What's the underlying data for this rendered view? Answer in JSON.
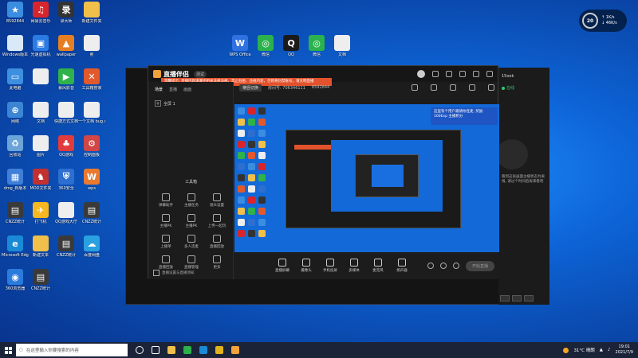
{
  "desktop": {
    "icons": [
      {
        "label": "8592844",
        "color": "#3b8de0",
        "glyph": "★"
      },
      {
        "label": "网易云音乐",
        "color": "#d8252b",
        "glyph": "♫"
      },
      {
        "label": "录大师",
        "color": "#333333",
        "glyph": "录"
      },
      {
        "label": "新建文件夹",
        "color": "#f0c04a",
        "glyph": ""
      },
      {
        "label": "Windows版本",
        "color": "#d9e9f7",
        "glyph": ""
      },
      {
        "label": "光速虚拟机",
        "color": "#2a7be4",
        "glyph": "▣"
      },
      {
        "label": "wallpaper",
        "color": "#e67e22",
        "glyph": "▲"
      },
      {
        "label": "照",
        "color": "#eeeeee",
        "glyph": ""
      },
      {
        "label": "此电脑",
        "color": "#3d8fe0",
        "glyph": "▭"
      },
      {
        "label": "",
        "color": "#eeeeee",
        "glyph": ""
      },
      {
        "label": "暴风影音",
        "color": "#2fb24a",
        "glyph": "▶"
      },
      {
        "label": "工具箱管家",
        "color": "#e2592c",
        "glyph": "✕"
      },
      {
        "label": "网络",
        "color": "#3b86d4",
        "glyph": "⊕"
      },
      {
        "label": "文档",
        "color": "#eeeeee",
        "glyph": ""
      },
      {
        "label": "快捷方式文档",
        "color": "#eeeeee",
        "glyph": ""
      },
      {
        "label": "一个文档 bug.docx",
        "color": "#eeeeee",
        "glyph": ""
      },
      {
        "label": "回收站",
        "color": "#6aa4d8",
        "glyph": "♻"
      },
      {
        "label": "图片",
        "color": "#eeeeee",
        "glyph": ""
      },
      {
        "label": "QQ游戏",
        "color": "#e23b3b",
        "glyph": "♣"
      },
      {
        "label": "控制面板",
        "color": "#d14646",
        "glyph": "⚙"
      },
      {
        "label": "dmg_新版本",
        "color": "#3f7fd8",
        "glyph": "▦"
      },
      {
        "label": "MOD文件夹",
        "color": "#c23030",
        "glyph": "♞"
      },
      {
        "label": "360安全",
        "color": "#2d6fd1",
        "glyph": "⛨"
      },
      {
        "label": "wps",
        "color": "#e97a2f",
        "glyph": "W"
      },
      {
        "label": "CNZZ统计",
        "color": "#3a3a3a",
        "glyph": "▤"
      },
      {
        "label": "打飞机",
        "color": "#f6b821",
        "glyph": "✈"
      },
      {
        "label": "QQ游戏大厅",
        "color": "#eeeeee",
        "glyph": ""
      },
      {
        "label": "CNZZ统计",
        "color": "#3a3a3a",
        "glyph": "▤"
      },
      {
        "label": "Microsoft Edge",
        "color": "#1b8ad6",
        "glyph": "e"
      },
      {
        "label": "新建文本",
        "color": "#f0c04a",
        "glyph": ""
      },
      {
        "label": "CNZZ统计",
        "color": "#3a3a3a",
        "glyph": "▤"
      },
      {
        "label": "百度网盘",
        "color": "#2aa0e0",
        "glyph": "☁"
      },
      {
        "label": "360浏览器",
        "color": "#2b7bdc",
        "glyph": "◉"
      },
      {
        "label": "CNZZ统计",
        "color": "#3a3a3a",
        "glyph": "▤"
      }
    ],
    "top_icons": [
      {
        "label": "WPS Office",
        "color": "#2f71e0",
        "glyph": "W"
      },
      {
        "label": "微信",
        "color": "#2bb24c",
        "glyph": "◎"
      },
      {
        "label": "QQ",
        "color": "#1a1a1a",
        "glyph": "Q"
      },
      {
        "label": "微信",
        "color": "#2bb24c",
        "glyph": "◎"
      },
      {
        "label": "文档",
        "color": "#eeeeee",
        "glyph": ""
      }
    ]
  },
  "widget": {
    "value": "20",
    "line1": "↑ 1K/s",
    "line2": "↓ 46K/s"
  },
  "app": {
    "name": "直播伴侣",
    "version": "测试",
    "notice": "温馨提示: 直播内容请遵守相关法律法规，禁止低俗、违规内容，否则将封禁账号，请文明直播",
    "tabs": [
      "场景",
      "直播",
      "画面"
    ],
    "scene_label": "全屏 1",
    "sub_bar": {
      "button": "横竖切换",
      "room": "房间号: 706346111",
      "stat": "8592844"
    },
    "toolbox_title": "工具箱",
    "tools": [
      "弹幕助手",
      "主播任务",
      "观众设置",
      "主播PK",
      "主播PK",
      "上传一起玩",
      "上播单",
      "多人连麦",
      "直播回放",
      "直播回放",
      "直播管理",
      "更多"
    ],
    "bottom_link": "直播设置与直播须知",
    "bottom_tools": [
      "直播屏幕",
      "摄像头",
      "手机投屏",
      "多媒体",
      "麦克风",
      "扬声器"
    ],
    "live_button": "开始直播",
    "popup_text": "这里有个用户邀请你连麦, 奖励100Exp 主播积分"
  },
  "right_panel": {
    "name": "15ook",
    "status": "在线",
    "text": "看到这张画面主播状态为离线, 请过个时间后再来看吧"
  },
  "taskbar": {
    "search_placeholder": "在这里输入你要搜索的内容",
    "weather": "31°C 晴朗",
    "time": "19:01",
    "date": "2021/7/9"
  }
}
